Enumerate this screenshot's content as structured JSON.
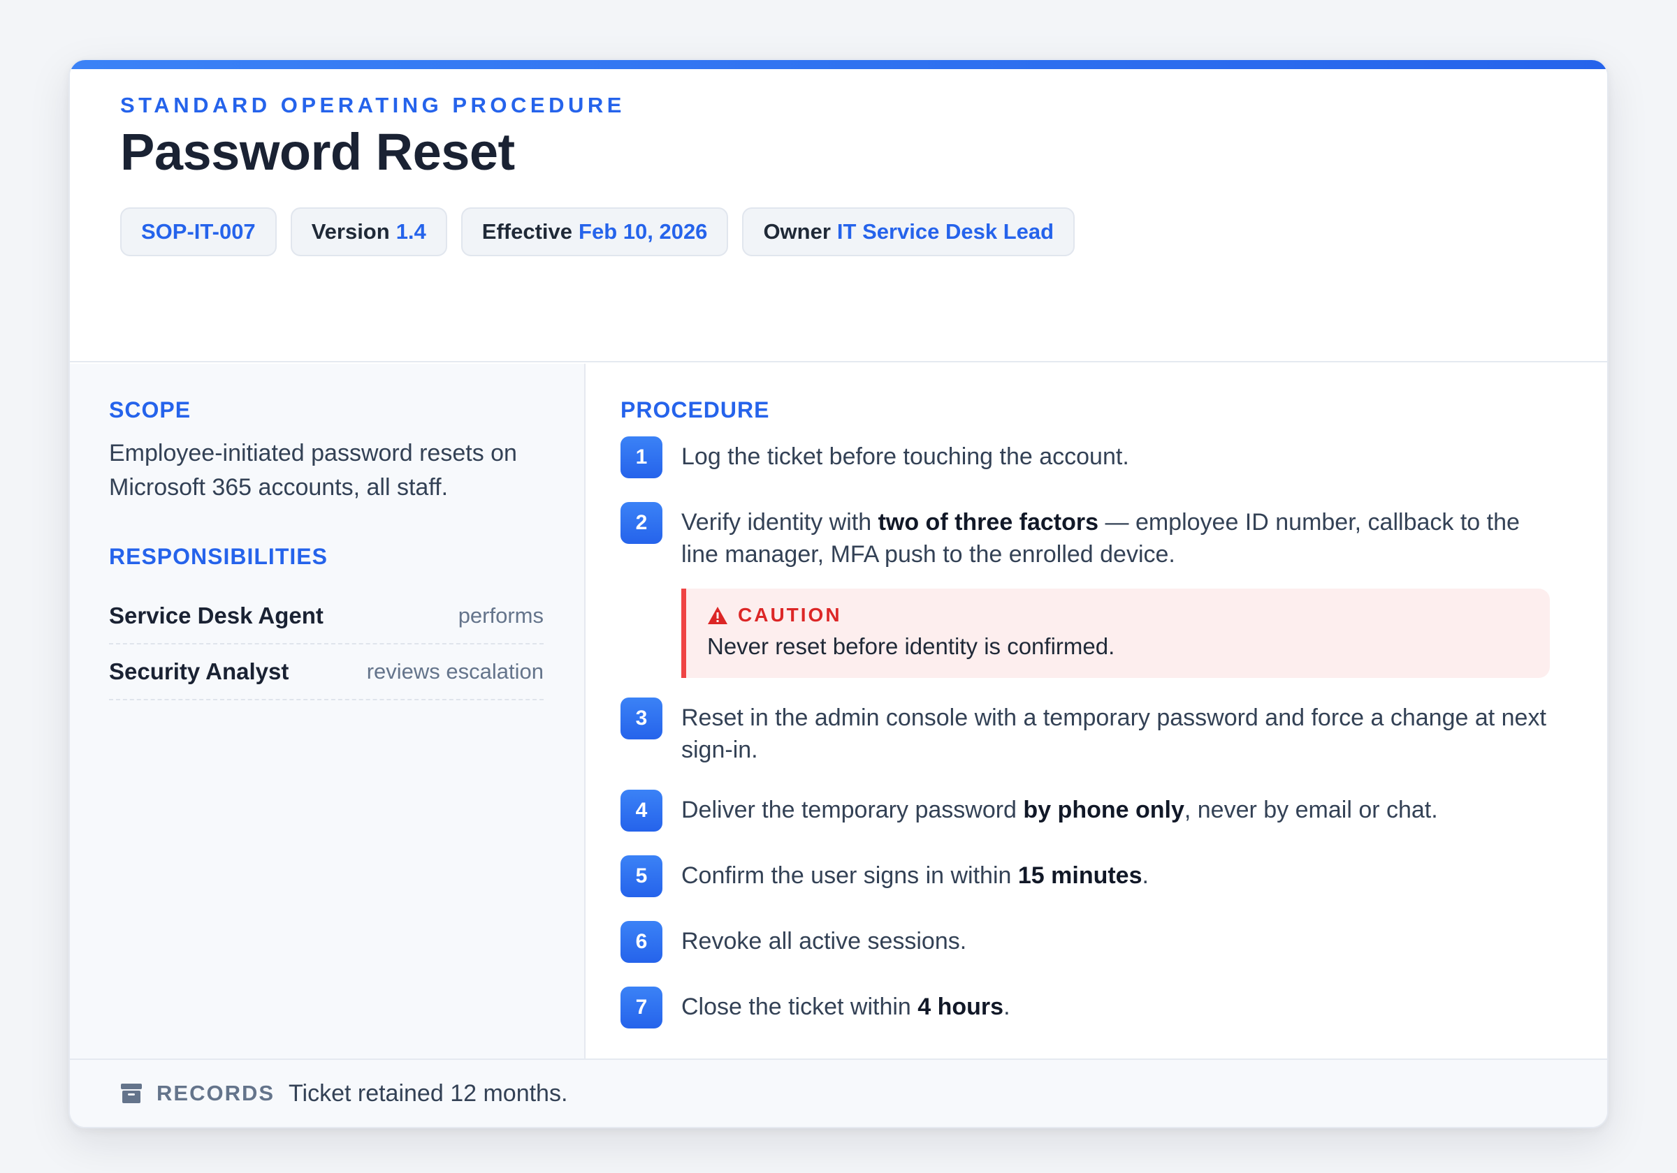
{
  "header": {
    "eyebrow": "STANDARD OPERATING PROCEDURE",
    "title": "Password Reset",
    "chips": {
      "id": "SOP-IT-007",
      "version_label": "Version",
      "version_value": "1.4",
      "effective_label": "Effective",
      "effective_value": "Feb 10, 2026",
      "owner_label": "Owner",
      "owner_value": "IT Service Desk Lead"
    }
  },
  "scope": {
    "heading": "SCOPE",
    "text": "Employee-initiated password resets on Microsoft 365 accounts, all staff."
  },
  "responsibilities": {
    "heading": "RESPONSIBILITIES",
    "rows": [
      {
        "role": "Service Desk Agent",
        "duty": "performs"
      },
      {
        "role": "Security Analyst",
        "duty": "reviews escalation"
      }
    ]
  },
  "procedure": {
    "heading": "PROCEDURE",
    "steps": [
      {
        "n": "1",
        "pre": "Log the ticket before touching the account.",
        "bold": "",
        "post": ""
      },
      {
        "n": "2",
        "pre": "Verify identity with ",
        "bold": "two of three factors",
        "post": " — employee ID number, callback to the line manager, MFA push to the enrolled device."
      },
      {
        "n": "3",
        "pre": "Reset in the admin console with a temporary password and force a change at next sign-in.",
        "bold": "",
        "post": ""
      },
      {
        "n": "4",
        "pre": "Deliver the temporary password ",
        "bold": "by phone only",
        "post": ", never by email or chat."
      },
      {
        "n": "5",
        "pre": "Confirm the user signs in within ",
        "bold": "15 minutes",
        "post": "."
      },
      {
        "n": "6",
        "pre": "Revoke all active sessions.",
        "bold": "",
        "post": ""
      },
      {
        "n": "7",
        "pre": "Close the ticket within ",
        "bold": "4 hours",
        "post": "."
      }
    ],
    "caution": {
      "label": "CAUTION",
      "text": "Never reset before identity is confirmed."
    }
  },
  "footer": {
    "label": "RECORDS",
    "text": "Ticket retained 12 months."
  },
  "colors": {
    "accent": "#2563eb",
    "caution": "#dc2626",
    "caution_bg": "#fdeeee"
  },
  "icons": {
    "caution": "warning-triangle-icon",
    "records": "archive-box-icon"
  }
}
